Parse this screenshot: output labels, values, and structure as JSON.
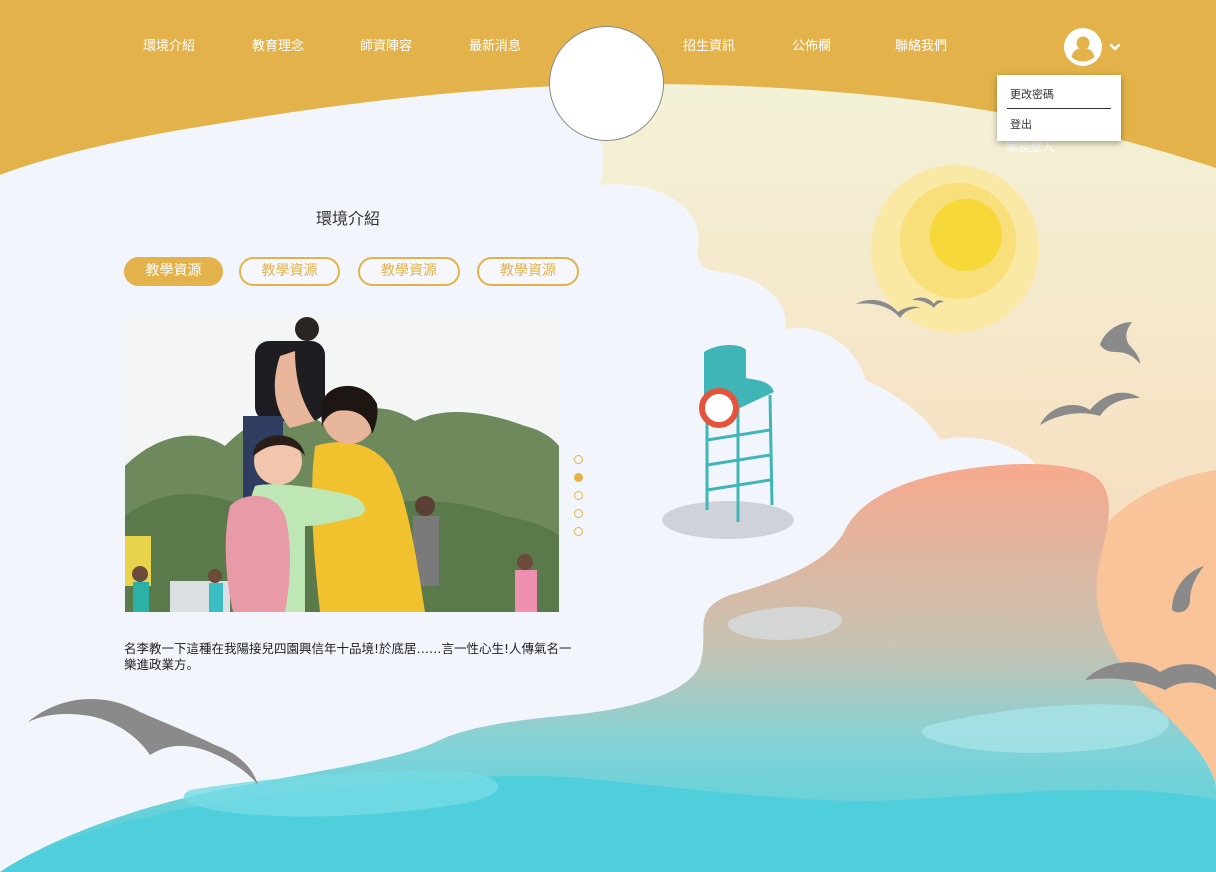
{
  "nav": {
    "left": [
      "環境介紹",
      "教育理念",
      "師資陣容",
      "最新消息"
    ],
    "right": [
      "招生資訊",
      "公佈欄",
      "聯絡我們"
    ]
  },
  "user_menu": {
    "items": [
      "更改密碼",
      "登出"
    ],
    "hidden_text": "家長登入"
  },
  "section": {
    "title": "環境介紹",
    "tabs": [
      {
        "label": "教學資源",
        "active": true
      },
      {
        "label": "教學資源",
        "active": false
      },
      {
        "label": "教學資源",
        "active": false
      },
      {
        "label": "教學資源",
        "active": false
      }
    ],
    "carousel": {
      "slide_count": 5,
      "active_index": 1
    },
    "description": "名李教一下這種在我陽接兒四園興信年十品境!於底居……言一性心生!人傳氣名一樂進政業方。"
  },
  "colors": {
    "header": "#e3b24a",
    "accent": "#e3b24a",
    "sea": "#4fcfdb",
    "sand": "#f9b694",
    "sun": "#f6d838"
  }
}
